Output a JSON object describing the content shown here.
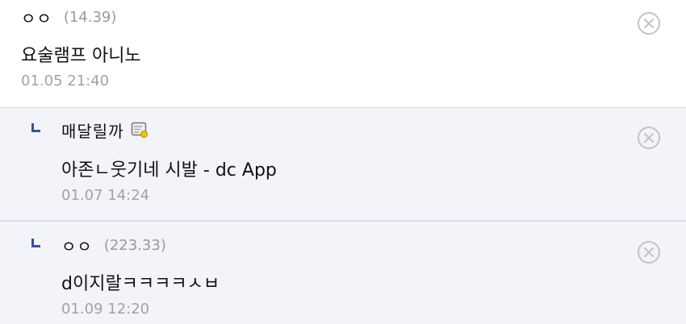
{
  "comments": [
    {
      "nickname": "ㅇㅇ",
      "ip": "(14.39)",
      "body": "요술램프 아니노",
      "date": "01.05 21:40",
      "is_reply": false
    },
    {
      "nickname": "매달릴까",
      "ip": "",
      "body": "아존ㄴ웃기네 시발 - dc App",
      "date": "01.07 14:24",
      "is_reply": true,
      "badge_icon": "gallog-icon"
    },
    {
      "nickname": "ㅇㅇ",
      "ip": "(223.33)",
      "body": "d이지랄ㅋㅋㅋㅋㅅㅂ",
      "date": "01.09 12:20",
      "is_reply": true
    }
  ],
  "icons": {
    "delete": "close-circle-icon",
    "reply": "reply-corner-icon"
  },
  "colors": {
    "reply_marker": "#3b4e9a",
    "reply_background": "#f3f4f9",
    "meta_text": "#9a9a9a"
  }
}
